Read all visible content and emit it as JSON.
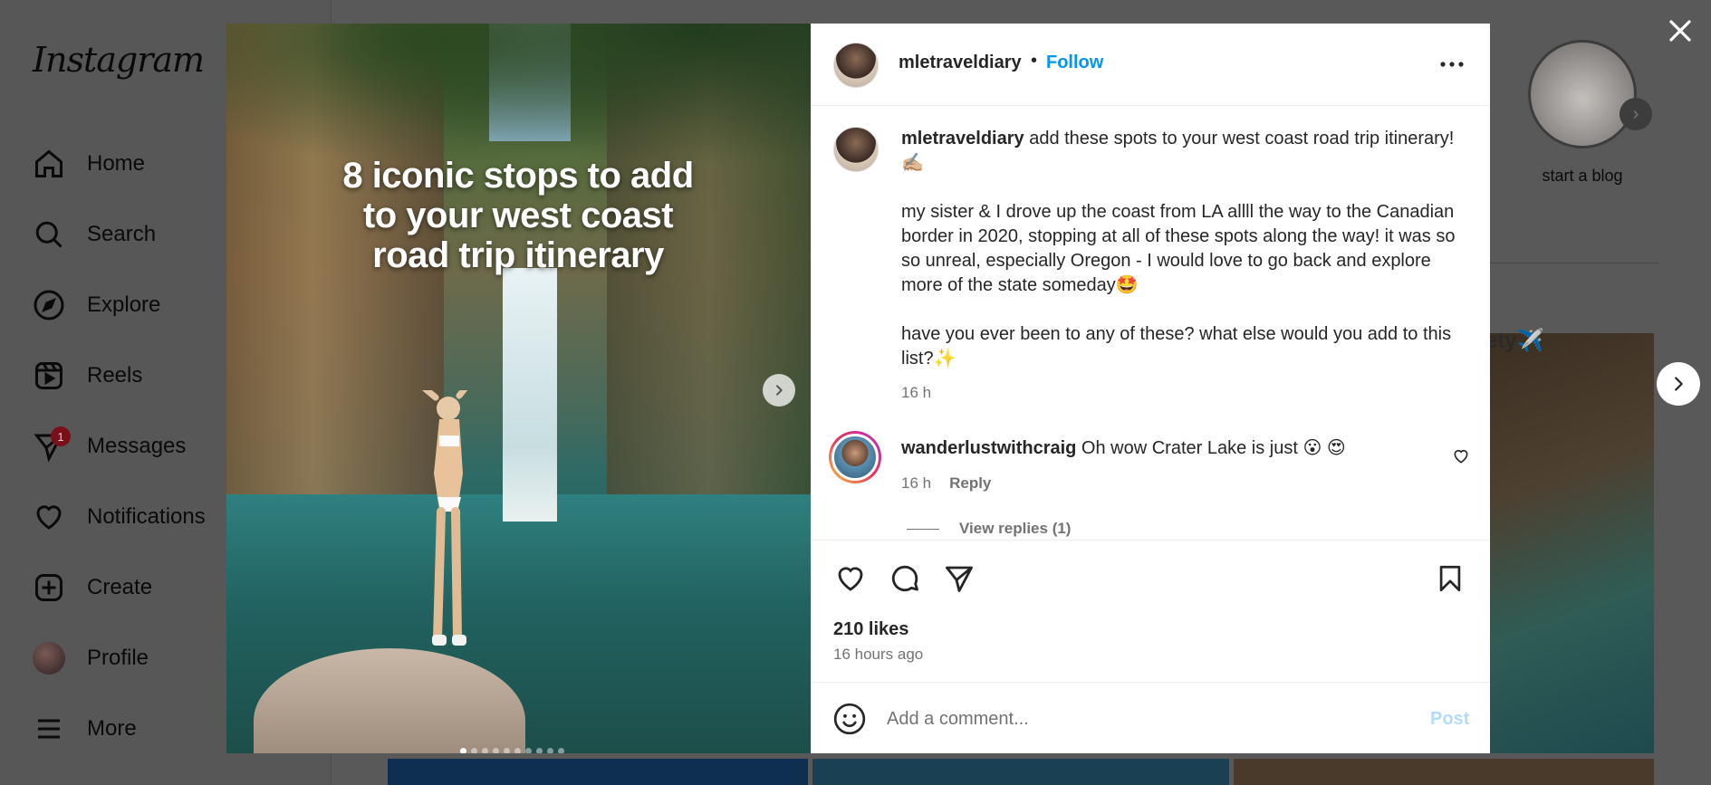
{
  "app": {
    "logo_text": "Instagram"
  },
  "sidebar": {
    "items": [
      {
        "label": "Home",
        "icon": "home-icon"
      },
      {
        "label": "Search",
        "icon": "search-icon"
      },
      {
        "label": "Explore",
        "icon": "compass-icon"
      },
      {
        "label": "Reels",
        "icon": "reels-icon"
      },
      {
        "label": "Messages",
        "icon": "messenger-icon",
        "badge": "1"
      },
      {
        "label": "Notifications",
        "icon": "heart-icon"
      },
      {
        "label": "Create",
        "icon": "plus-square-icon"
      },
      {
        "label": "Profile",
        "icon": "avatar"
      },
      {
        "label": "More",
        "icon": "hamburger-icon"
      }
    ]
  },
  "background": {
    "story_label": "start a blog",
    "tile_text": "ety✈️"
  },
  "media": {
    "overlay_title": "8 iconic stops to add\nto your west coast\nroad trip itinerary",
    "slide_count": 10,
    "active_slide": 1
  },
  "post": {
    "username": "mletraveldiary",
    "separator": "•",
    "follow_label": "Follow",
    "caption_user": "mletraveldiary",
    "caption_text": " add these spots to your west coast road trip itinerary! ✍🏼\n\nmy sister & I drove up the coast from LA allll the way to the Canadian border in 2020, stopping at all of these spots along the way! it was so so unreal, especially Oregon - I would love to go back and explore more of the state someday🤩\n\nhave you ever been to any of these? what else would you add to this list?✨",
    "caption_time": "16 h",
    "likes": "210 likes",
    "time_ago": "16 hours ago"
  },
  "comments": [
    {
      "user": "wanderlustwithcraig",
      "text": " Oh wow Crater Lake is just 😮 😍",
      "time": "16 h",
      "reply_label": "Reply",
      "view_replies": "View replies (1)"
    }
  ],
  "composer": {
    "placeholder": "Add a comment...",
    "post_label": "Post"
  },
  "colors": {
    "follow": "#0095f6",
    "post_disabled": "#b3dbff",
    "secondary_text": "#737373",
    "badge": "#ff3040"
  }
}
